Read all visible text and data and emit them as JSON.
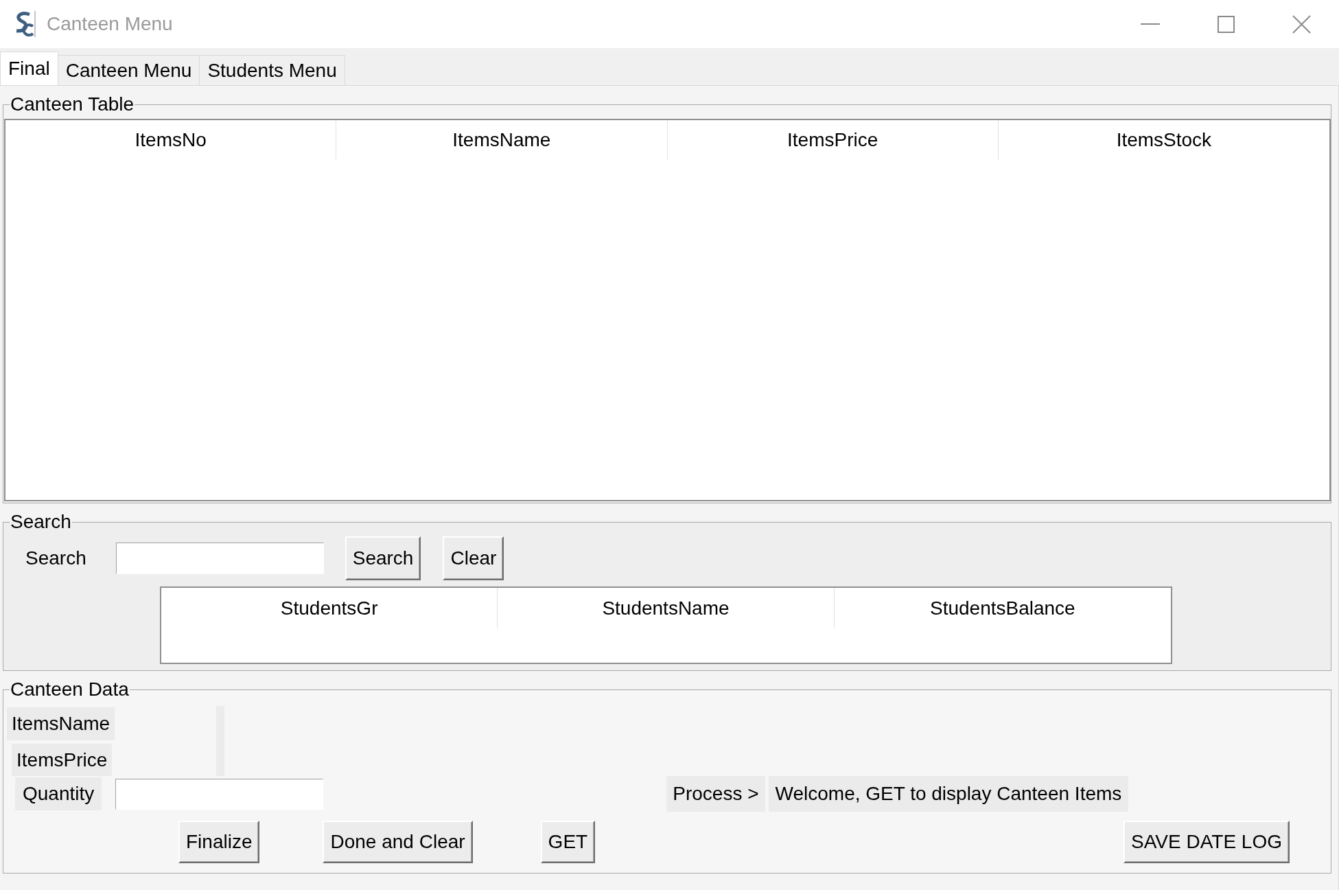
{
  "window": {
    "title": "Canteen Menu"
  },
  "tabs": [
    {
      "label": "Final",
      "selected": true
    },
    {
      "label": "Canteen Menu",
      "selected": false
    },
    {
      "label": "Students Menu",
      "selected": false
    }
  ],
  "canteen_table": {
    "title": "Canteen Table",
    "columns": [
      "ItemsNo",
      "ItemsName",
      "ItemsPrice",
      "ItemsStock"
    ]
  },
  "search": {
    "title": "Search",
    "label": "Search",
    "buttons": [
      "Search",
      "Clear"
    ],
    "students_table": {
      "columns": [
        "StudentsGr",
        "StudentsName",
        "StudentsBalance"
      ]
    }
  },
  "canteen_data": {
    "title": "Canteen Data",
    "labels": [
      "ItemsName",
      "ItemsPrice"
    ],
    "quantity_label": "Quantity",
    "process_label": "Process >",
    "status_message": "Welcome, GET to display Canteen Items",
    "buttons": [
      "Finalize",
      "Done and Clear",
      "GET",
      "SAVE DATE LOG"
    ]
  }
}
